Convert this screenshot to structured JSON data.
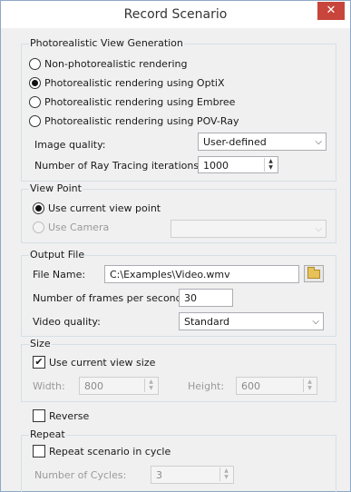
{
  "window": {
    "title": "Record Scenario",
    "close_glyph": "✕"
  },
  "photoreal": {
    "legend": "Photorealistic View Generation",
    "options": [
      {
        "label": "Non-photorealistic rendering",
        "checked": false
      },
      {
        "label": "Photorealistic rendering using OptiX",
        "checked": true
      },
      {
        "label": "Photorealistic rendering using Embree",
        "checked": false
      },
      {
        "label": "Photorealistic rendering using POV-Ray",
        "checked": false
      }
    ],
    "image_quality_label": "Image quality:",
    "image_quality_value": "User-defined",
    "iterations_label": "Number of Ray Tracing iterations:",
    "iterations_value": "1000"
  },
  "viewpoint": {
    "legend": "View Point",
    "current_label": "Use current view point",
    "camera_label": "Use Camera",
    "camera_value": ""
  },
  "output": {
    "legend": "Output File",
    "file_name_label": "File Name:",
    "file_name_value": "C:\\Examples\\Video.wmv",
    "fps_label": "Number of frames per second:",
    "fps_value": "30",
    "video_quality_label": "Video quality:",
    "video_quality_value": "Standard"
  },
  "size": {
    "legend": "Size",
    "current_label": "Use current view size",
    "checked": true,
    "width_label": "Width:",
    "width_value": "800",
    "height_label": "Height:",
    "height_value": "600"
  },
  "reverse": {
    "label": "Reverse",
    "checked": false
  },
  "repeat": {
    "legend": "Repeat",
    "cycle_label": "Repeat scenario in cycle",
    "checked": false,
    "cycles_label": "Number of Cycles:",
    "cycles_value": "3"
  },
  "glyphs": {
    "dropdown_arrow": "⌵",
    "spin_up": "▲",
    "spin_down": "▼",
    "check": "✔"
  }
}
